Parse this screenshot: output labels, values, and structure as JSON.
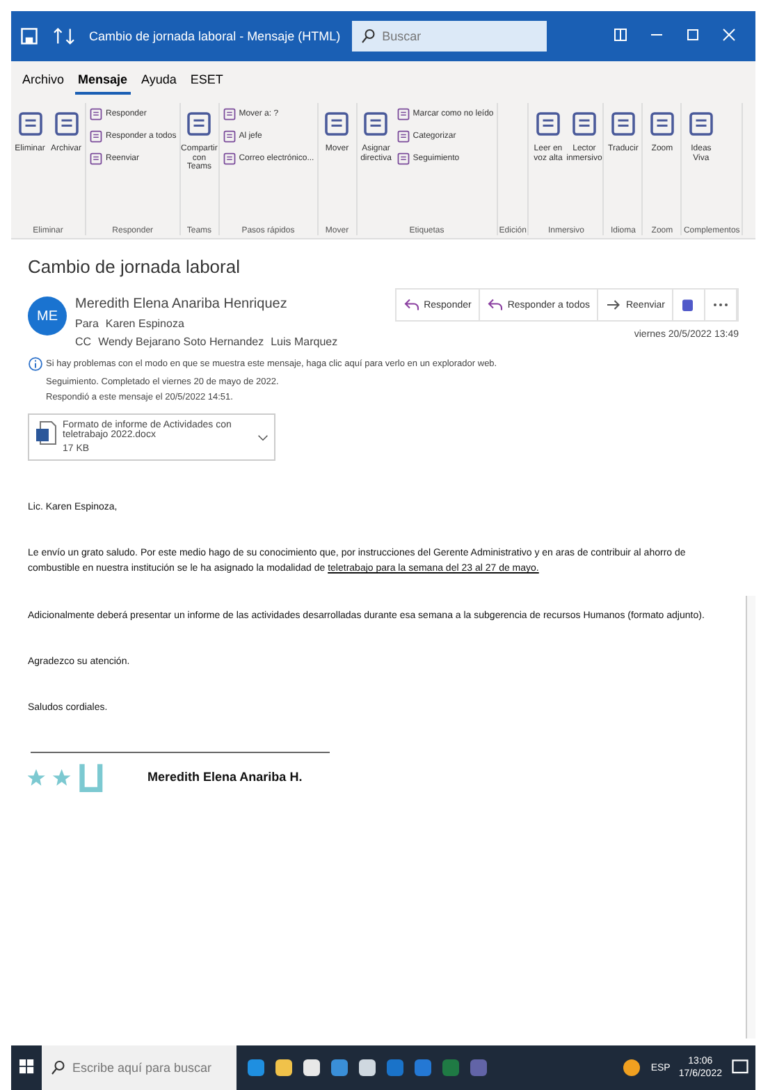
{
  "window": {
    "title": "Cambio de jornada laboral - Mensaje (HTML)",
    "search_placeholder": "Buscar"
  },
  "tabs": [
    {
      "label": "Archivo",
      "selected": false
    },
    {
      "label": "Mensaje",
      "selected": true
    },
    {
      "label": "Ayuda",
      "selected": false
    },
    {
      "label": "ESET",
      "selected": false
    }
  ],
  "ribbon": [
    {
      "group": "Eliminar",
      "items": [
        {
          "kind": "large",
          "label": "Eliminar"
        },
        {
          "kind": "large",
          "label": "Archivar"
        }
      ]
    },
    {
      "group": "Responder",
      "items": [
        {
          "kind": "small",
          "label": "Responder"
        },
        {
          "kind": "small",
          "label": "Responder a todos"
        },
        {
          "kind": "small",
          "label": "Reenviar"
        }
      ]
    },
    {
      "group": "Teams",
      "items": [
        {
          "kind": "large",
          "label": "Compartir con Teams"
        }
      ]
    },
    {
      "group": "Pasos rápidos",
      "items": [
        {
          "kind": "small",
          "label": "Mover a: ?"
        },
        {
          "kind": "small",
          "label": "Al jefe"
        },
        {
          "kind": "small",
          "label": "Correo electrónico..."
        }
      ]
    },
    {
      "group": "Mover",
      "items": [
        {
          "kind": "large",
          "label": "Mover"
        }
      ]
    },
    {
      "group": "Etiquetas",
      "items": [
        {
          "kind": "large",
          "label": "Asignar directiva"
        },
        {
          "kind": "small",
          "label": "Marcar como no leído"
        },
        {
          "kind": "small",
          "label": "Categorizar"
        },
        {
          "kind": "small",
          "label": "Seguimiento"
        }
      ]
    },
    {
      "group": "Edición"
    },
    {
      "group": "Inmersivo",
      "items": [
        {
          "kind": "large",
          "label": "Leer en voz alta"
        },
        {
          "kind": "large",
          "label": "Lector inmersivo"
        }
      ]
    },
    {
      "group": "Idioma",
      "items": [
        {
          "kind": "large",
          "label": "Traducir"
        }
      ]
    },
    {
      "group": "Zoom",
      "items": [
        {
          "kind": "large",
          "label": "Zoom"
        }
      ]
    },
    {
      "group": "Complementos",
      "items": [
        {
          "kind": "large",
          "label": "Ideas Viva"
        }
      ]
    }
  ],
  "message": {
    "subject": "Cambio de jornada laboral",
    "initials": "ME",
    "sender": "Meredith Elena Anariba Henriquez",
    "to_label": "Para",
    "to": [
      "Karen Espinoza"
    ],
    "cc_label": "CC",
    "cc": [
      "Wendy Bejarano Soto Hernandez",
      "Luis Marquez"
    ],
    "actions": [
      "Responder",
      "Responder a todos",
      "Reenviar"
    ],
    "date": "viernes 20/5/2022 13:49",
    "info": [
      "Si hay problemas con el modo en que se muestra este mensaje, haga clic aquí para verlo en un explorador web.",
      "Seguimiento. Completado el viernes 20 de mayo de 2022.",
      "Respondió a este mensaje el 20/5/2022 14:51."
    ],
    "attachment": {
      "name": "Formato de informe de Actividades con teletrabajo 2022.docx",
      "size": "17 KB"
    },
    "body": [
      {
        "text": "Lic. Karen Espinoza,"
      },
      {
        "text": "Le envío un grato saludo. Por este medio hago de su conocimiento que, por instrucciones del Gerente Administrativo y en aras de contribuir al ahorro de combustible en nuestra institución se le ha asignado la modalidad de ",
        "underlined": "teletrabajo para la semana del 23 al 27 de mayo."
      },
      {
        "text": "Adicionalmente deberá presentar un informe de las actividades desarrolladas durante esa semana a la subgerencia de recursos Humanos (formato adjunto)."
      },
      {
        "text": "Agradezco su atención."
      },
      {
        "text": "Saludos cordiales."
      }
    ],
    "signature": "Meredith Elena Anariba H."
  },
  "taskbar": {
    "search_placeholder": "Escribe aquí para buscar",
    "language": "ESP",
    "time": "13:06",
    "date": "17/6/2022"
  }
}
